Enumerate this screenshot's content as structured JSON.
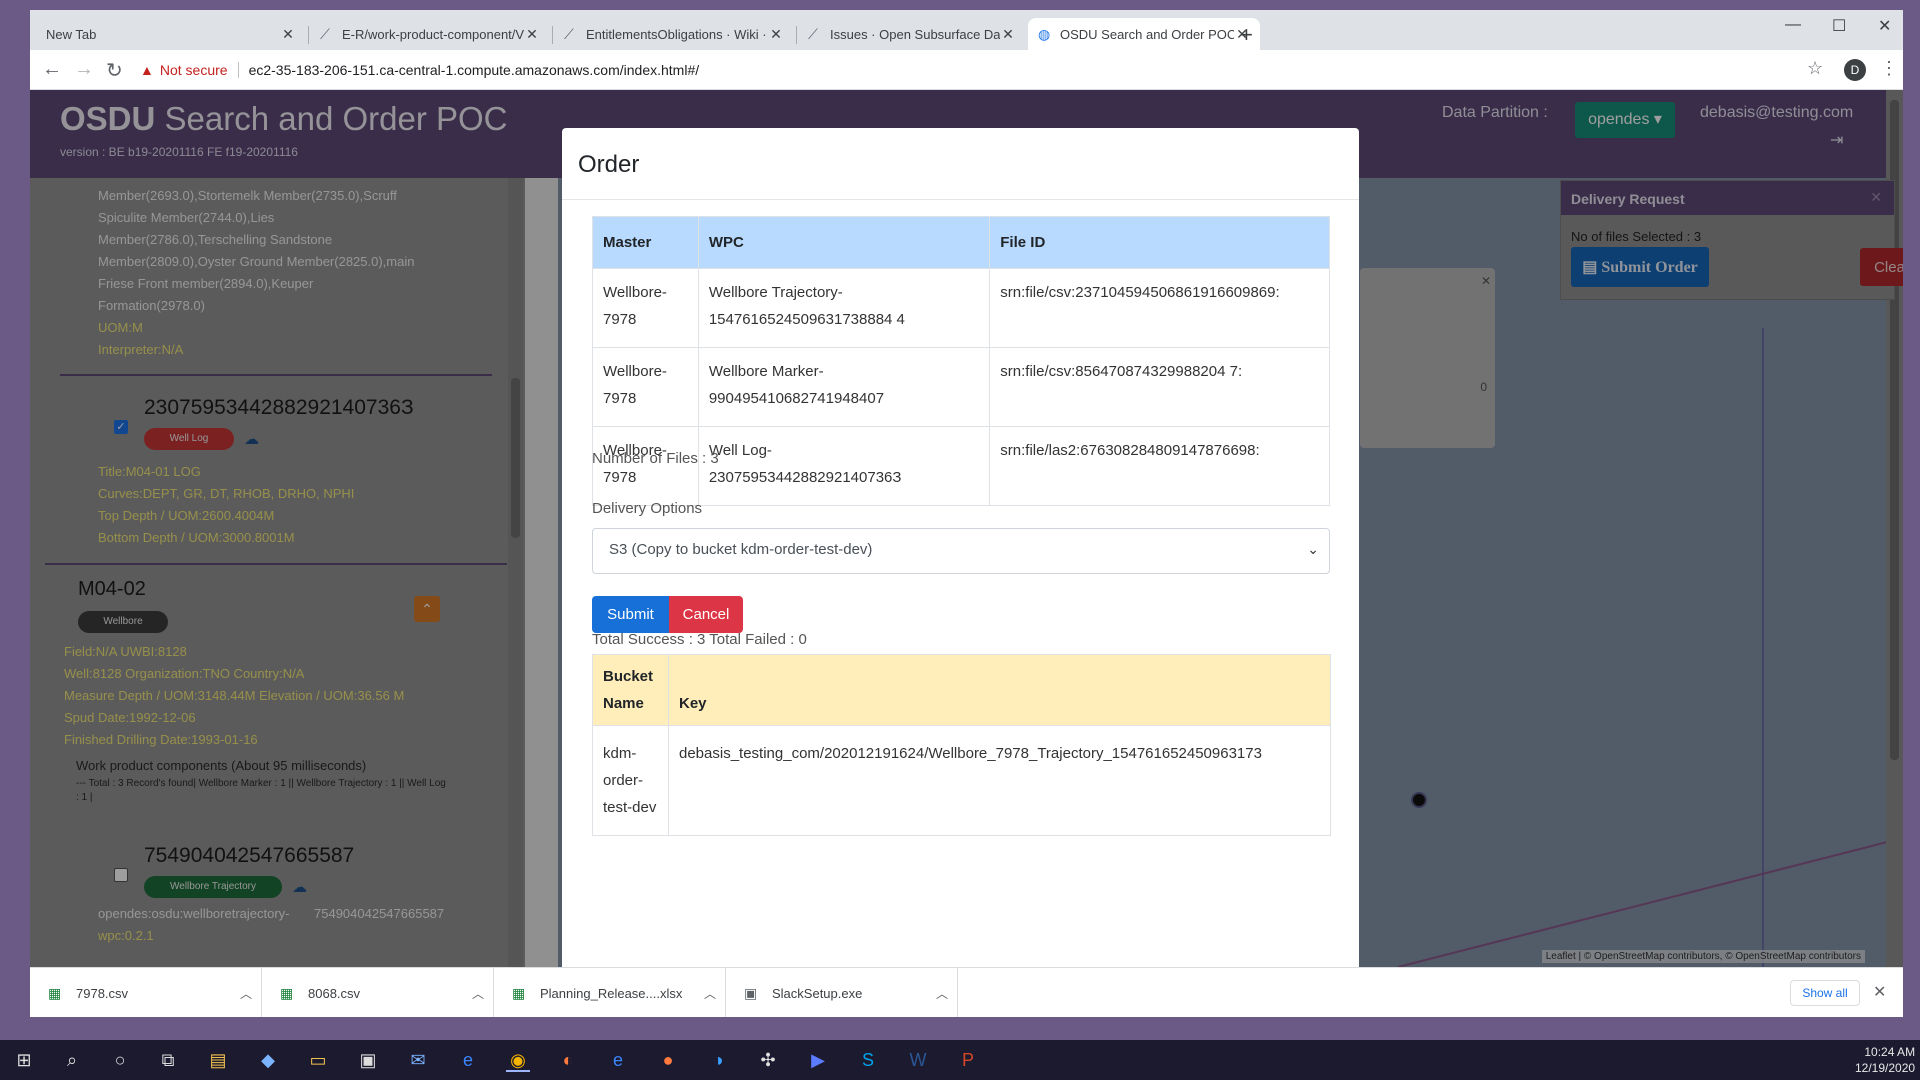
{
  "browser": {
    "tabs": [
      {
        "title": "New Tab",
        "active": false
      },
      {
        "title": "E-R/work-product-component/V",
        "active": false
      },
      {
        "title": "EntitlementsObligations · Wiki · C",
        "active": false
      },
      {
        "title": "Issues · Open Subsurface Data U",
        "active": false
      },
      {
        "title": "OSDU Search and Order POC",
        "active": true
      }
    ],
    "not_secure": "Not secure",
    "url": "ec2-35-183-206-151.ca-central-1.compute.amazonaws.com/index.html#/",
    "profile_initial": "D"
  },
  "app": {
    "title_bold": "OSDU",
    "title_rest": " Search and Order POC",
    "version": "version : BE b19-20201116 FE f19-20201116",
    "data_partition_label": "Data Partition :",
    "data_partition_value": "opendes",
    "user_email": "debasis@testing.com"
  },
  "left_panel": {
    "top_lines": [
      "Member(2693.0),Stortemelk Member(2735.0),Scruff",
      "Spiculite Member(2744.0),Lies",
      "Member(2786.0),Terschelling Sandstone",
      "Member(2809.0),Oyster Ground Member(2825.0),main",
      "Friese Front member(2894.0),Keuper",
      "Formation(2978.0)",
      "UOM:M",
      "Interpreter:N/A"
    ],
    "record1": {
      "id": "2307595344288292140736З",
      "badge": "Well Log",
      "lines": [
        "Title:M04-01 LOG",
        "Curves:DEPT, GR, DT, RHOB, DRHO, NPHI",
        "Top Depth / UOM:2600.4004M",
        "Bottom Depth / UOM:3000.8001M"
      ]
    },
    "well": {
      "name": "M04-02",
      "badge": "Wellbore",
      "lines": [
        "Field:N/A     UWBI:8128",
        "Well:8128 Organization:TNO Country:N/A",
        "Measure Depth / UOM:3148.44M Elevation / UOM:36.56 M",
        "Spud Date:1992-12-06",
        "Finished Drilling Date:1993-01-16"
      ],
      "wpc_title": "Work product components (About 95 milliseconds)",
      "wpc_line1": "--- Total : 3 Record's found| Wellbore Marker : 1 || Wellbore Trajectory : 1 || Well Log",
      "wpc_line2": ": 1 |"
    },
    "record2": {
      "id": "754904042547665587",
      "badge": "Wellbore Trajectory",
      "line1_left": "opendes:osdu:wellboretrajectory-",
      "line1_right": "754904042547665587",
      "line2": "wpc:0.2.1"
    }
  },
  "delivery_request": {
    "title": "Delivery Request",
    "count_label": "No of files Selected : 3",
    "submit_label": "Submit Order",
    "clear_label": "Clear"
  },
  "map": {
    "attribution": "Leaflet | © OpenStreetMap contributors, © OpenStreetMap contributors",
    "popup_digit": "0"
  },
  "modal": {
    "title": "Order",
    "files_table": {
      "headers": [
        "Master",
        "WPC",
        "File ID"
      ],
      "rows": [
        {
          "master": [
            "Wellbore-",
            "7978"
          ],
          "wpc": [
            "Wellbore Trajectory-",
            "1547616524509631738884 4"
          ],
          "file_id": "srn:file/csv:237104594506861916609869:"
        },
        {
          "master": [
            "Wellbore-",
            "7978"
          ],
          "wpc": [
            "Wellbore Marker-",
            "990495410682741948407"
          ],
          "file_id": "srn:file/csv:856470874329988204 7:"
        },
        {
          "master": [
            "Wellbore-",
            "7978"
          ],
          "wpc": [
            "Well Log-",
            "2307595344288292140736З"
          ],
          "file_id": "srn:file/las2:676308284809147876698:"
        }
      ]
    },
    "number_of_files": "Number of Files : 3",
    "delivery_options_label": "Delivery Options",
    "delivery_option_selected": "S3 (Copy to bucket kdm-order-test-dev)",
    "submit_label": "Submit",
    "cancel_label": "Cancel",
    "totals": "Total Success : 3 Total Failed : 0",
    "result_table": {
      "headers": [
        "Bucket Name",
        "Key"
      ],
      "rows": [
        {
          "bucket": "kdm-order-test-dev",
          "key": "debasis_testing_com/202012191624/Wellbore_7978_Trajectory_154761652450963173"
        }
      ]
    }
  },
  "downloads": {
    "items": [
      "7978.csv",
      "8068.csv",
      "Planning_Release....xlsx",
      "SlackSetup.exe"
    ],
    "show_all": "Show all"
  },
  "taskbar": {
    "time": "10:24 AM",
    "date": "12/19/2020"
  }
}
